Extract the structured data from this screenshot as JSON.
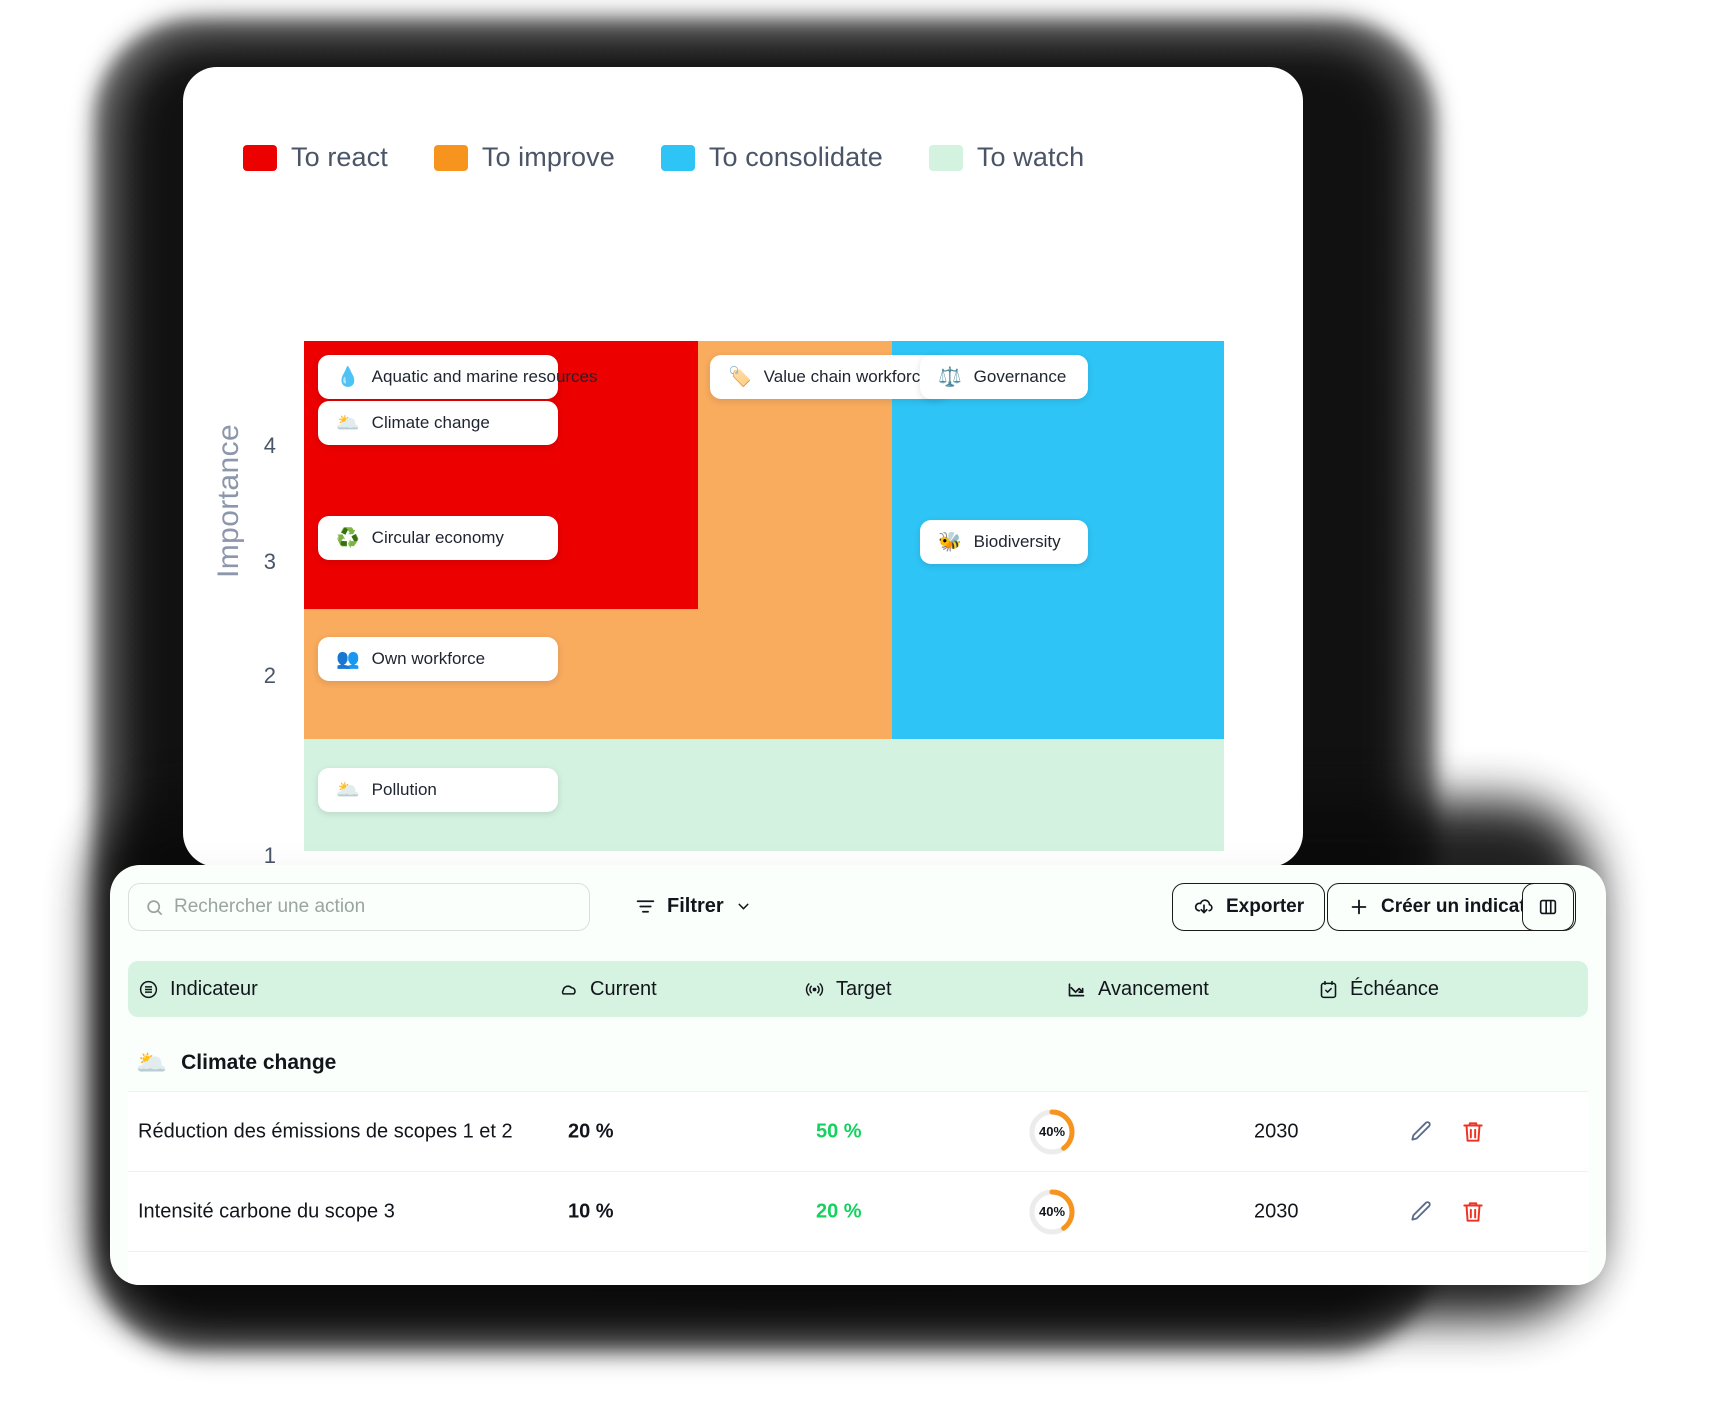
{
  "chart_data": {
    "type": "heatmap",
    "title": "",
    "ylabel": "Importance",
    "xlabel": "",
    "ylim": [
      1,
      5
    ],
    "yticks": [
      "4",
      "3",
      "2",
      "1"
    ],
    "grid": false,
    "legend_position": "top-left",
    "legend": [
      {
        "label": "To react",
        "color": "#ec0000"
      },
      {
        "label": "To improve",
        "color": "#f7941d"
      },
      {
        "label": "To consolidate",
        "color": "#2ec5f6"
      },
      {
        "label": "To watch",
        "color": "#d4f2e0"
      }
    ],
    "zones": [
      {
        "name": "To watch",
        "color": "#d4f2e0"
      },
      {
        "name": "To improve",
        "color": "#f9ab5e"
      },
      {
        "name": "To consolidate",
        "color": "#2ec5f6"
      },
      {
        "name": "To react",
        "color": "#ec0000"
      }
    ],
    "items": [
      {
        "label": "Aquatic and marine resources",
        "emoji": "💧",
        "zone": "To react"
      },
      {
        "label": "Climate change",
        "emoji": "🌥️",
        "zone": "To react"
      },
      {
        "label": "Circular economy",
        "emoji": "♻️",
        "zone": "To react"
      },
      {
        "label": "Own workforce",
        "emoji": "👥",
        "zone": "To improve"
      },
      {
        "label": "Value chain workforce",
        "emoji": "🏷️",
        "zone": "To improve"
      },
      {
        "label": "Governance",
        "emoji": "⚖️",
        "zone": "To consolidate"
      },
      {
        "label": "Biodiversity",
        "emoji": "🐝",
        "zone": "To consolidate"
      },
      {
        "label": "Pollution",
        "emoji": "🌥️",
        "zone": "To watch"
      }
    ]
  },
  "toolbar": {
    "search_placeholder": "Rechercher une action",
    "search_value": "",
    "filter_label": "Filtrer",
    "export_label": "Exporter",
    "create_label": "Créer un indicateur"
  },
  "table": {
    "columns": [
      {
        "label": "Indicateur",
        "icon": "list-icon"
      },
      {
        "label": "Current",
        "icon": "cloud-icon"
      },
      {
        "label": "Target",
        "icon": "broadcast-icon"
      },
      {
        "label": "Avancement",
        "icon": "trend-icon"
      },
      {
        "label": "Échéance",
        "icon": "calendar-icon"
      }
    ],
    "groups": [
      {
        "label": "Climate change",
        "emoji": "🌥️",
        "rows": [
          {
            "name": "Réduction des émissions de scopes 1 et 2",
            "current": "20 %",
            "target": "50 %",
            "progress": "40%",
            "progress_value": 40,
            "deadline": "2030"
          },
          {
            "name": "Intensité carbone du scope 3",
            "current": "10 %",
            "target": "20 %",
            "progress": "40%",
            "progress_value": 40,
            "deadline": "2030"
          }
        ]
      }
    ]
  },
  "colors": {
    "target_green": "#15d15f",
    "progress_orange": "#f7941d",
    "delete_red": "#ef3124",
    "header_green": "#d6f2e1"
  }
}
